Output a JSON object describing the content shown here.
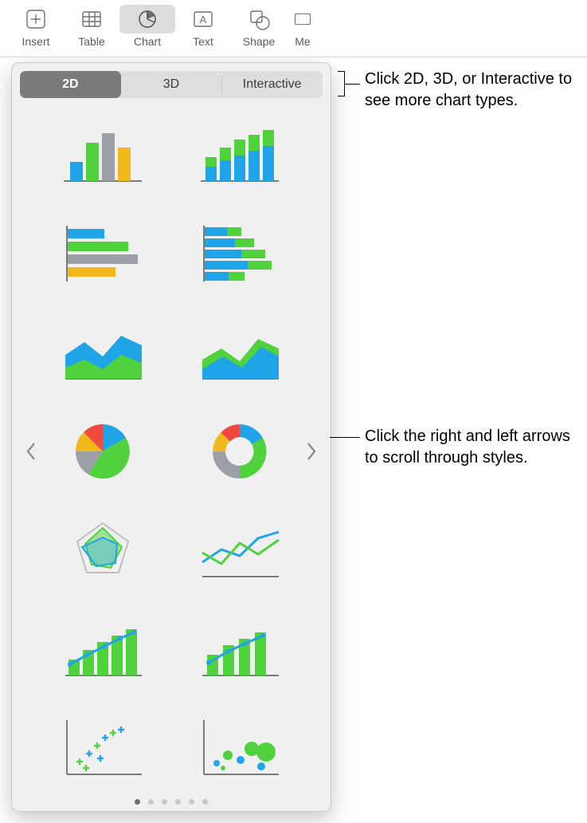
{
  "toolbar": {
    "items": [
      {
        "id": "insert",
        "label": "Insert"
      },
      {
        "id": "table",
        "label": "Table"
      },
      {
        "id": "chart",
        "label": "Chart",
        "active": true
      },
      {
        "id": "text",
        "label": "Text"
      },
      {
        "id": "shape",
        "label": "Shape"
      },
      {
        "id": "media",
        "label": "Me"
      }
    ]
  },
  "popover": {
    "tabs": [
      "2D",
      "3D",
      "Interactive"
    ],
    "selected_tab_index": 0,
    "page_count": 6,
    "selected_page_index": 0,
    "chart_types": [
      "bar-vertical",
      "bar-vertical-stacked",
      "bar-horizontal",
      "bar-horizontal-stacked",
      "area-stacked",
      "area-overlap",
      "pie",
      "donut",
      "radar",
      "line-multi",
      "combo-bar-line-1",
      "combo-bar-line-2",
      "scatter-cross",
      "bubble"
    ]
  },
  "callouts": {
    "tabs": "Click 2D, 3D, or Interactive to see more chart types.",
    "arrows": "Click the right and left arrows to scroll through styles."
  },
  "palette": {
    "blue": "#1fa4e8",
    "green": "#4fd23c",
    "yellow": "#f0b81a",
    "gray": "#9aa0a6",
    "red": "#f04a3e",
    "axis": "#7b7b7b"
  }
}
